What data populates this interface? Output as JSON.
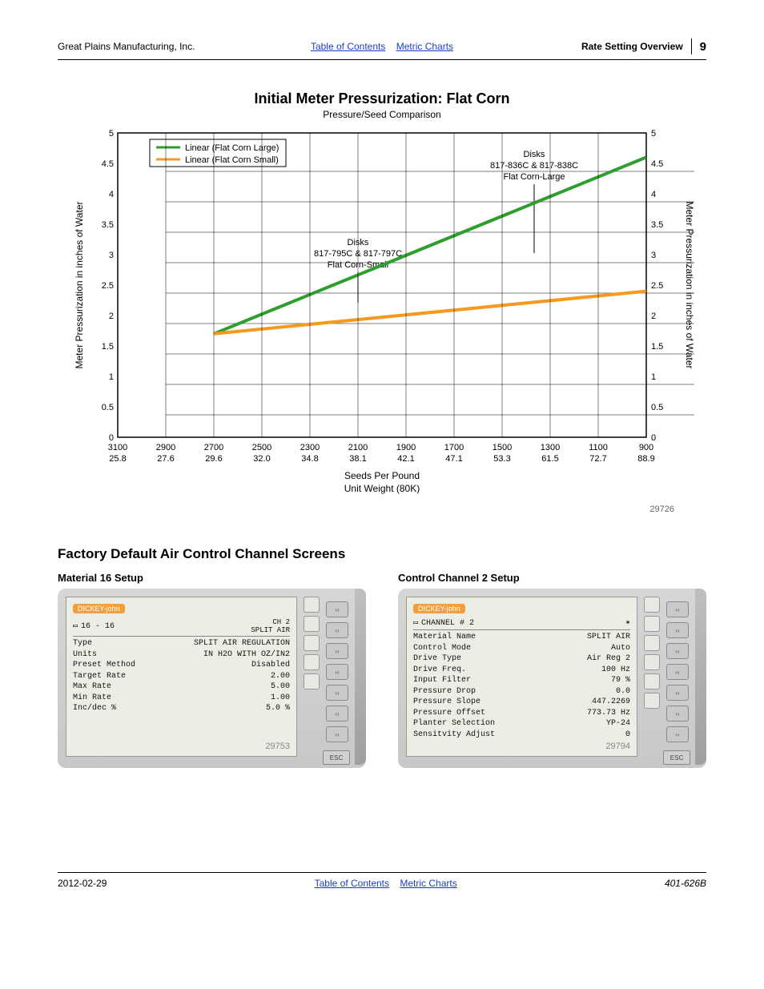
{
  "header": {
    "company": "Great Plains Manufacturing, Inc.",
    "link_toc": "Table of Contents",
    "link_metric": "Metric Charts",
    "section": "Rate Setting Overview",
    "page_no": "9"
  },
  "chart_data": {
    "type": "line",
    "title": "Initial Meter Pressurization: Flat Corn",
    "subtitle": "Pressure/Seed Comparison",
    "ylabel_left": "Meter Pressurization in inches of Water",
    "ylabel_right": "Meter Pressurization in inches of Water",
    "xlabel_top": "Seeds Per Pound",
    "xlabel_bottom": "Unit Weight (80K)",
    "ylim": [
      0,
      5
    ],
    "yticks": [
      0,
      0.5,
      1,
      1.5,
      2,
      2.5,
      3,
      3.5,
      4,
      4.5,
      5
    ],
    "x_categories_seeds": [
      "3100",
      "2900",
      "2700",
      "2500",
      "2300",
      "2100",
      "1900",
      "1700",
      "1500",
      "1300",
      "1100",
      "900"
    ],
    "x_categories_weight": [
      "25.8",
      "27.6",
      "29.6",
      "32.0",
      "34.8",
      "38.1",
      "42.1",
      "47.1",
      "53.3",
      "61.5",
      "72.7",
      "88.9"
    ],
    "legend": [
      "Linear (Flat Corn Large)",
      "Linear (Flat Corn Small)"
    ],
    "series": [
      {
        "name": "Linear (Flat Corn Large)",
        "color": "#2e9e2e",
        "x": [
          "2700",
          "900"
        ],
        "y": [
          1.7,
          4.6
        ]
      },
      {
        "name": "Linear (Flat Corn Small)",
        "color": "#f59a1f",
        "x": [
          "2700",
          "900"
        ],
        "y": [
          1.7,
          2.4
        ]
      }
    ],
    "annotations": [
      {
        "heading": "Disks",
        "lines": [
          "817-836C & 817-838C",
          "Flat Corn-Large"
        ]
      },
      {
        "heading": "Disks",
        "lines": [
          "817-795C & 817-797C",
          "Flat Corn-Small"
        ]
      }
    ],
    "figure_id": "29726"
  },
  "section_title": "Factory Default Air Control Channel Screens",
  "panels": {
    "left": {
      "title": "Material 16 Setup",
      "brand": "DICKEY-john",
      "header_line": {
        "left": "16 - 16",
        "right": "CH 2\nSPLIT AIR"
      },
      "rows": [
        {
          "l": "Type",
          "r": "SPLIT AIR REGULATION"
        },
        {
          "l": "Units",
          "r": "IN H2O WITH OZ/IN2"
        },
        {
          "l": "Preset Method",
          "r": "Disabled"
        },
        {
          "l": "Target Rate",
          "r": "2.00"
        },
        {
          "l": "Max Rate",
          "r": "5.00"
        },
        {
          "l": "Min Rate",
          "r": "1.00"
        },
        {
          "l": "Inc/dec %",
          "r": "5.0 %"
        }
      ],
      "footer_id": "29753"
    },
    "right": {
      "title": "Control Channel 2 Setup",
      "brand": "DICKEY-john",
      "header_line": {
        "left": "CHANNEL # 2",
        "right": ""
      },
      "rows": [
        {
          "l": "Material Name",
          "r": "SPLIT AIR"
        },
        {
          "l": "Control Mode",
          "r": "Auto"
        },
        {
          "l": "Drive Type",
          "r": "Air Reg 2"
        },
        {
          "l": "Drive Freq.",
          "r": "100 Hz"
        },
        {
          "l": "Input Filter",
          "r": "79 %"
        },
        {
          "l": "Pressure Drop",
          "r": "0.0"
        },
        {
          "l": "Pressure Slope",
          "r": "447.2269"
        },
        {
          "l": "Pressure Offset",
          "r": "773.73 Hz"
        },
        {
          "l": "Planter Selection",
          "r": "YP-24"
        },
        {
          "l": "Sensitvity Adjust",
          "r": "0"
        }
      ],
      "footer_id": "29794"
    },
    "esc_label": "ESC"
  },
  "footer": {
    "date": "2012-02-29",
    "link_toc": "Table of Contents",
    "link_metric": "Metric Charts",
    "doc_id": "401-626B"
  }
}
